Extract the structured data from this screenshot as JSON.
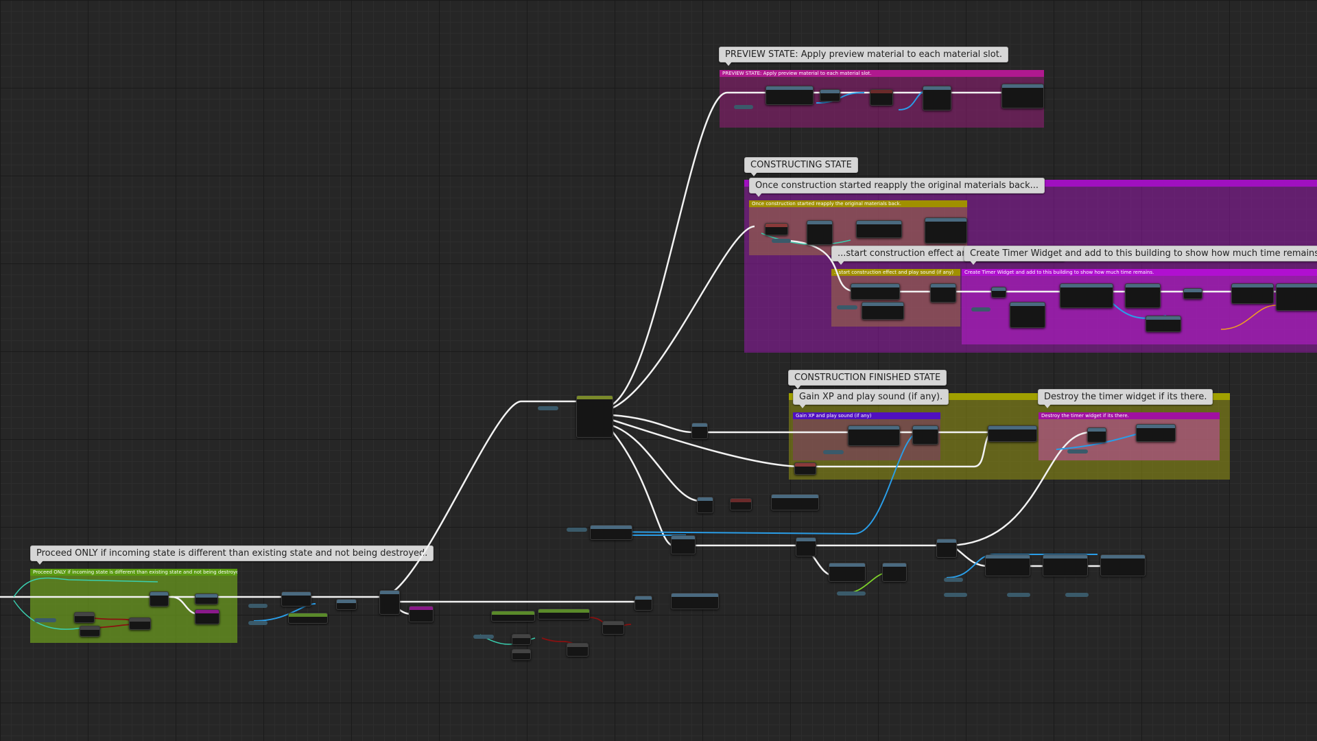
{
  "comments": {
    "preview_title": "PREVIEW STATE: Apply preview material to each material slot.",
    "preview_header": "PREVIEW STATE: Apply preview material to each material slot.",
    "constructing_title": "CONSTRUCTING STATE",
    "reapply_bubble": "Once construction started reapply the original materials back...",
    "reapply_header": "Once construction started reapply the original materials back.",
    "effect_bubble": "...start construction effect and play sound (if any)",
    "timer_bubble": "Create Timer Widget and add to this building to show how much time remains.",
    "effect_header": "...start construction effect and play sound (if any)",
    "timer_header": "Create Timer Widget and add to this building to show how much time remains.",
    "finished_title": "CONSTRUCTION FINISHED STATE",
    "gainxp_bubble": "Gain XP and play sound (if any).",
    "gainxp_header": "Gain XP and play sound (if any)",
    "destroy_bubble": "Destroy the timer widget if its there.",
    "destroy_header": "Destroy the timer widget if its there.",
    "proceed_bubble": "Proceed ONLY if incoming state is different than existing state and not being destroyed.",
    "proceed_header": "Proceed ONLY if incoming state is different than existing state and not being destroyed."
  },
  "colors": {
    "background": "#262626",
    "exec_wire": "#f2f2f2",
    "object_wire": "#2a9ee8",
    "bool_wire": "#8a1010",
    "green_wire": "#7ed32a",
    "preview_comment": "#7a1f66",
    "constructing_comment": "#7a1a8e",
    "finished_comment": "#7a7a10",
    "proceed_comment": "#5a8a1a"
  }
}
